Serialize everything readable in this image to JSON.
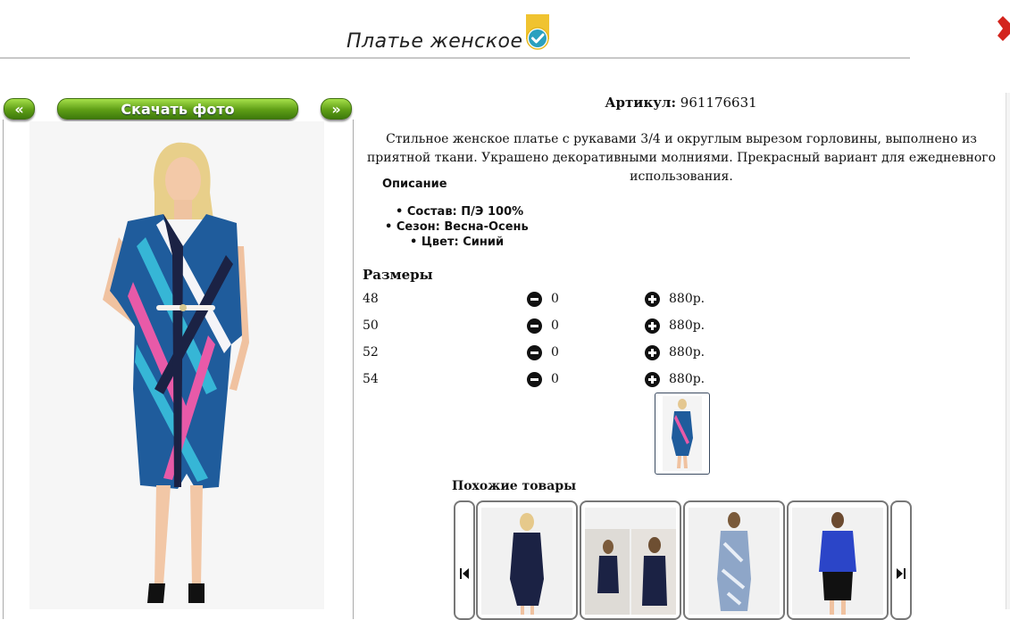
{
  "header": {
    "title": "Платье женское",
    "badge_icon": "verified-check-icon",
    "close_icon": "close-icon"
  },
  "photo_panel": {
    "prev_label": "«",
    "download_label": "Скачать фото",
    "next_label": "»"
  },
  "product": {
    "sku_label": "Артикул:",
    "sku_value": "961176631",
    "description": "Стильное женское платье с рукавами 3/4 и округлым вырезом горловины, выполнено из приятной ткани. Украшено декоративными молниями. Прекрасный вариант для ежедневного использования.",
    "desc_heading": "Описание",
    "props": [
      "Состав: П/Э 100%",
      "Сезон: Весна-Осень",
      "Цвет: Синий"
    ]
  },
  "sizes": {
    "heading": "Размеры",
    "rows": [
      {
        "size": "48",
        "qty": "0",
        "price": "880р."
      },
      {
        "size": "50",
        "qty": "0",
        "price": "880р."
      },
      {
        "size": "52",
        "qty": "0",
        "price": "880р."
      },
      {
        "size": "54",
        "qty": "0",
        "price": "880р."
      }
    ]
  },
  "similar": {
    "heading": "Похожие товары"
  },
  "colors": {
    "button_green": "#5e9e16",
    "dress_blue": "#1f5c9c",
    "dress_pink": "#e85aa8",
    "dress_navy": "#1b2244"
  }
}
